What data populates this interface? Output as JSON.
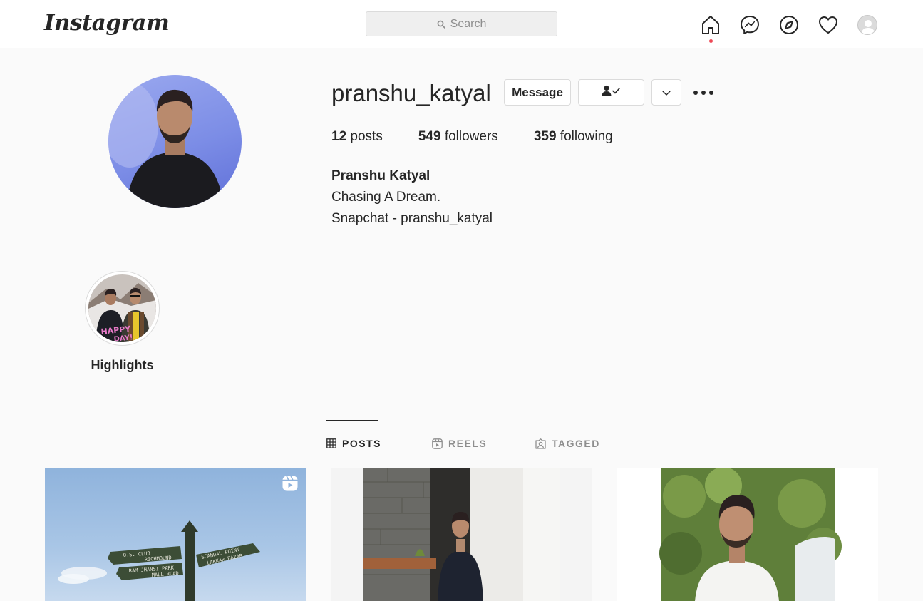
{
  "nav": {
    "logo": "Instagram",
    "search_placeholder": "Search",
    "icons": [
      "home-icon",
      "messenger-icon",
      "explore-icon",
      "activity-heart-icon",
      "profile-avatar"
    ]
  },
  "profile": {
    "username": "pranshu_katyal",
    "message_button": "Message",
    "stats": {
      "posts_count": "12",
      "posts_label": "posts",
      "followers_count": "549",
      "followers_label": "followers",
      "following_count": "359",
      "following_label": "following"
    },
    "full_name": "Pranshu Katyal",
    "bio_lines": [
      "Chasing A Dream.",
      "Snapchat - pranshu_katyal"
    ]
  },
  "highlights": [
    {
      "label": "Highlights"
    }
  ],
  "tabs": [
    {
      "label": "POSTS",
      "active": true
    },
    {
      "label": "REELS",
      "active": false
    },
    {
      "label": "TAGGED",
      "active": false
    }
  ],
  "posts": [
    {
      "type": "reel"
    },
    {
      "type": "photo"
    },
    {
      "type": "photo"
    }
  ],
  "colors": {
    "notification_dot": "#ed4956",
    "text": "#262626",
    "secondary_text": "#8e8e8e",
    "border": "#dbdbdb"
  }
}
